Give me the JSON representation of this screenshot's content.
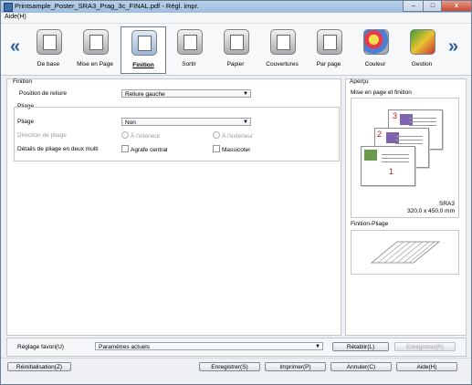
{
  "window": {
    "title": "Printsample_Poster_SRA3_Prag_3c_FINAL.pdf - Régl. impr.",
    "close": "x"
  },
  "menu": {
    "help": "Aide(H)"
  },
  "toolbar": {
    "prev": "«",
    "next": "»",
    "tabs": [
      {
        "label": "De base"
      },
      {
        "label": "Mise en Page"
      },
      {
        "label": "Finition"
      },
      {
        "label": "Sortir"
      },
      {
        "label": "Papier"
      },
      {
        "label": "Couvertures"
      },
      {
        "label": "Par page"
      },
      {
        "label": "Couleur"
      },
      {
        "label": "Gestion"
      }
    ],
    "selected": "Finition"
  },
  "finition": {
    "group_title": "Finition",
    "binding_label": "Position de reliure",
    "binding_value": "Reliure gauche",
    "pliage_group": "Pliage",
    "pliage_label": "Pliage",
    "pliage_value": "Non",
    "direction_label": "Direction de pliage",
    "direction_inside": "À l'intérieur",
    "direction_outside": "À l'extérieur",
    "multi_label": "Détails de pliage en deux multi",
    "staple_label": "Agrafe central",
    "trimmer_label": "Massicoter"
  },
  "apercu": {
    "title": "Aperçu",
    "layout_title": "Mise en page et finition",
    "paper_name": "SRA3",
    "paper_size": "320,0 x 450,0 mm",
    "pages": [
      "1",
      "2",
      "3"
    ],
    "fold_title": "Finition-Pliage"
  },
  "favorites": {
    "label": "Réglage favori(U)",
    "value": "Paramètres actuels",
    "recall": "Rétablir(L)",
    "register": "Enregistrer(R)"
  },
  "footer": {
    "reset": "Réinitialisation(Z)",
    "save": "Enregistrer(S)",
    "print": "Imprimer(P)",
    "cancel": "Annuler(C)",
    "help": "Aide(H)"
  }
}
